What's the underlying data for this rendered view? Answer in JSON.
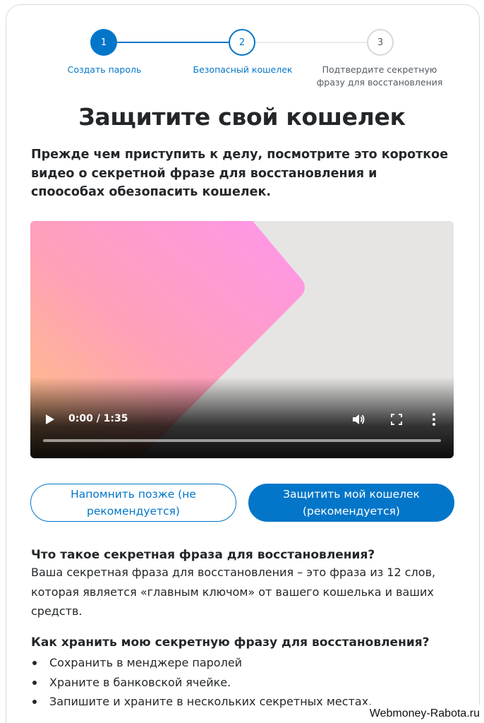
{
  "stepper": {
    "steps": [
      {
        "number": "1",
        "label": "Создать пароль",
        "state": "complete"
      },
      {
        "number": "2",
        "label": "Безопасный кошелек",
        "state": "active"
      },
      {
        "number": "3",
        "label": "Подтвердите секретную фразу для восстановления",
        "state": "pending"
      }
    ]
  },
  "page": {
    "title": "Защитите свой кошелек",
    "intro": "Прежде чем приступить к делу, посмотрите это короткое видео о секретной фразе для восстановления и споособах обезопасить кошелек."
  },
  "video": {
    "time": "0:00 / 1:35",
    "progress": 0,
    "controls": [
      "play-icon",
      "volume-icon",
      "fullscreen-icon",
      "more-options-icon"
    ]
  },
  "buttons": {
    "remind_later": "Напомнить позже (не рекомендуется)",
    "secure_wallet": "Защитить мой кошелек (рекомендуется)"
  },
  "info": {
    "what_title": "Что такое секретная фраза для восстановления?",
    "what_text": "Ваша секретная фраза для восстановления – это фраза из 12 слов, которая является «главным ключом» от вашего кошелька и ваших средств.",
    "how_title": "Как хранить мою секретную фразу для восстановления?",
    "tips": [
      "Сохранить в менджере паролей",
      "Храните в банковской ячейке.",
      "Запишите и храните в нескольких секретных местах."
    ]
  },
  "colors": {
    "accent": "#0376c9",
    "text": "#24272a",
    "muted": "#535a61",
    "border": "#d6d9dc"
  },
  "watermark": "Webmoney-Rabota.ru"
}
